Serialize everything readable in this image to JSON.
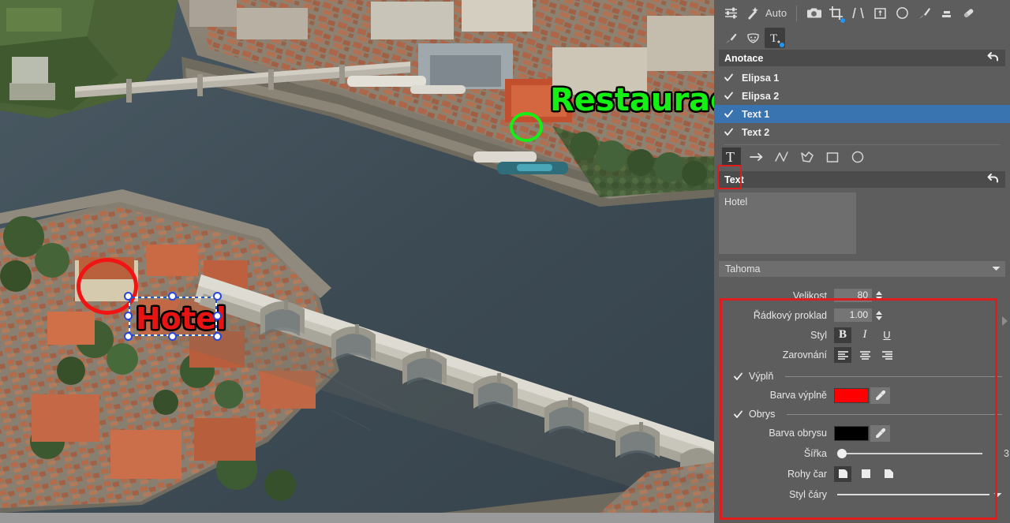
{
  "app": {
    "locale": "cs",
    "panel_bg": "#5d5d5d",
    "header_bg": "#4b4b4b",
    "selection_bg": "#3a74b0",
    "highlight_color": "#e01d1d"
  },
  "toolbar": {
    "row1": [
      {
        "name": "adjustments-icon",
        "label": ""
      },
      {
        "name": "magic-wand-icon",
        "label": ""
      },
      {
        "name": "auto-label",
        "label": "Auto"
      },
      {
        "name": "camera-icon",
        "label": ""
      },
      {
        "name": "crop-icon",
        "label": ""
      },
      {
        "name": "perspective-icon",
        "label": ""
      },
      {
        "name": "rotate-frame-icon",
        "label": ""
      },
      {
        "name": "circle-icon",
        "label": ""
      },
      {
        "name": "brush-icon",
        "label": ""
      },
      {
        "name": "gradient-icon",
        "label": ""
      },
      {
        "name": "eraser-icon",
        "label": ""
      }
    ],
    "row2": [
      {
        "name": "retouch-brush-icon",
        "label": ""
      },
      {
        "name": "face-mask-icon",
        "label": ""
      },
      {
        "name": "text-tool-icon",
        "label": ""
      }
    ],
    "auto_label": "Auto"
  },
  "annotations_panel": {
    "title": "Anotace",
    "undo_glyph": "↩",
    "items": [
      {
        "label": "Elipsa 1",
        "checked": true,
        "selected": false
      },
      {
        "label": "Elipsa 2",
        "checked": true,
        "selected": false
      },
      {
        "label": "Text 1",
        "checked": true,
        "selected": true
      },
      {
        "label": "Text 2",
        "checked": true,
        "selected": false
      }
    ],
    "shape_tools": [
      {
        "name": "text-shape-tool",
        "glyph": "T",
        "active": true
      },
      {
        "name": "arrow-shape-tool",
        "glyph": "→",
        "active": false
      },
      {
        "name": "polyline-shape-tool",
        "glyph": "",
        "active": false
      },
      {
        "name": "polygon-shape-tool",
        "glyph": "",
        "active": false
      },
      {
        "name": "rectangle-shape-tool",
        "glyph": "",
        "active": false
      },
      {
        "name": "ellipse-shape-tool",
        "glyph": "",
        "active": false
      }
    ]
  },
  "text_panel": {
    "title": "Text",
    "undo_glyph": "↩",
    "content": "Hotel",
    "content_placeholder": "",
    "font_family": "Tahoma",
    "size": {
      "label": "Velikost",
      "value": "80"
    },
    "line_spacing": {
      "label": "Řádkový proklad",
      "value": "1.00"
    },
    "style": {
      "label": "Styl",
      "buttons": [
        {
          "name": "bold-button",
          "glyph": "B",
          "active": true
        },
        {
          "name": "italic-button",
          "glyph": "I",
          "active": false
        },
        {
          "name": "underline-button",
          "glyph": "U",
          "active": false
        }
      ]
    },
    "alignment": {
      "label": "Zarovnání",
      "buttons": [
        {
          "name": "align-left-button",
          "active": true
        },
        {
          "name": "align-center-button",
          "active": false
        },
        {
          "name": "align-right-button",
          "active": false
        }
      ]
    },
    "fill": {
      "section_label": "Výplň",
      "checked": true,
      "color_label": "Barva výplně",
      "color": "#fe0000"
    },
    "outline": {
      "section_label": "Obrys",
      "checked": true,
      "color_label": "Barva obrysu",
      "color": "#000000",
      "width_label": "Šířka",
      "width_value": "3",
      "width_pct": 3,
      "corners_label": "Rohy čar",
      "corner_buttons": [
        {
          "name": "corner-round-button",
          "active": true
        },
        {
          "name": "corner-square-button",
          "active": false
        },
        {
          "name": "corner-bevel-button",
          "active": false
        }
      ],
      "line_style_label": "Styl čáry",
      "line_style_value": "solid"
    }
  },
  "canvas": {
    "annotations": [
      {
        "name": "ellipse-annotation-restaurace",
        "type": "ellipse",
        "color": "#14f014"
      },
      {
        "name": "ellipse-annotation-hotel",
        "type": "ellipse",
        "color": "#f01414"
      },
      {
        "name": "text-annotation-restaurace",
        "type": "text",
        "text": "Restaurace",
        "fill": "#14f014",
        "outline": "#000000"
      },
      {
        "name": "text-annotation-hotel",
        "type": "text",
        "text": "Hotel",
        "fill": "#e81414",
        "outline": "#000000",
        "selected": true
      }
    ]
  }
}
